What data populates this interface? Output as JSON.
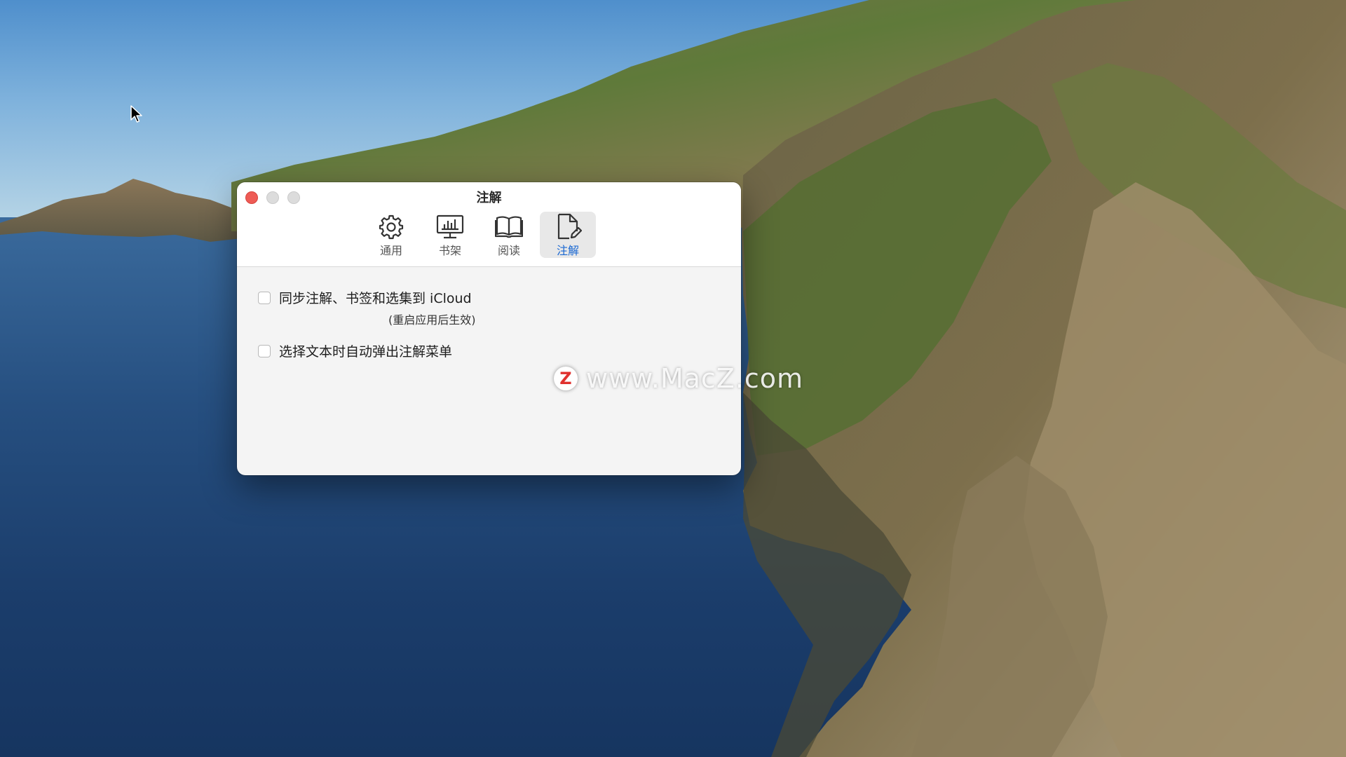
{
  "window": {
    "title": "注解"
  },
  "toolbar": {
    "tabs": [
      {
        "label": "通用",
        "icon": "gear-icon"
      },
      {
        "label": "书架",
        "icon": "bookshelf-icon"
      },
      {
        "label": "阅读",
        "icon": "open-book-icon"
      },
      {
        "label": "注解",
        "icon": "annotate-document-icon",
        "active": true
      }
    ]
  },
  "options": {
    "sync_icloud": {
      "label": "同步注解、书签和选集到 iCloud",
      "checked": false,
      "note": "(重启应用后生效)"
    },
    "auto_popup": {
      "label": "选择文本时自动弹出注解菜单",
      "checked": false
    }
  },
  "watermark": {
    "badge": "Z",
    "text": "www.MacZ.com"
  },
  "colors": {
    "close": "#ee5b55",
    "accent": "#1a68d2",
    "watermark_badge": "#e0312e"
  }
}
